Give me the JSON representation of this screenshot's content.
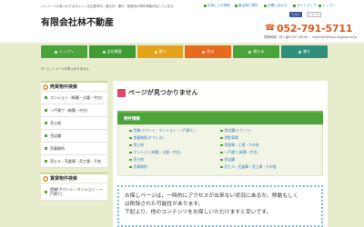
{
  "header": {
    "tagline": "ｘｘページの見つかりませんｘｘ名古屋市内・春日井・瀬戸・尾張旭の物件情報が探しています。",
    "company": "有限会社林不動産",
    "top_links": [
      {
        "label": "お気に入り物件",
        "icon": "heart-icon"
      },
      {
        "label": "最近見た物件",
        "icon": "clock-icon"
      },
      {
        "label": "お問い合わせ",
        "icon": "mail-icon"
      },
      {
        "label": "サイトマップ",
        "icon": "sitemap-icon"
      },
      {
        "label": "トップへ",
        "icon": "home-icon"
      }
    ],
    "facebook_label": "いいね！",
    "tweet_label": "ツイート",
    "tel": "052-791-5711",
    "tel_icon": "phone-icon",
    "hours": "営業時間／月～金9:30～18:00 ｜ fudo-sen@mun.bigjobe.ne.jp"
  },
  "nav": [
    {
      "label": "トップへ",
      "color": "#4aa33b"
    },
    {
      "label": "会社概要",
      "color": "#3f9b34"
    },
    {
      "label": "買う",
      "color": "#e3a31b"
    },
    {
      "label": "売る",
      "color": "#e86a1f"
    },
    {
      "label": "借りる",
      "color": "#4aa33b"
    },
    {
      "label": "貸す",
      "color": "#2e8f7a"
    }
  ],
  "breadcrumb": "ホーム ＞ ページが見つかりません",
  "sidebar": {
    "heading": "売買物件検索",
    "heading_icon": "circle-bullet-icon",
    "items": [
      {
        "label": "マンション（新築・分譲・中古）"
      },
      {
        "label": "一戸建て（新築・中古）"
      },
      {
        "label": "売土地"
      },
      {
        "label": "売店舗"
      },
      {
        "label": "売事務所"
      },
      {
        "label": "売ビル・売倉庫・売工場・そ他"
      }
    ],
    "heading2": "賃貸物件検索",
    "items2": [
      {
        "label": "賃貸(アパート・マンション・一戸建て)"
      }
    ]
  },
  "main": {
    "title": "ページが見つかりません",
    "list_heading": "物件情報",
    "property_links": [
      [
        "賃貸(アパート・マンション・一戸建て)",
        "賃店舗(テナント)"
      ],
      [
        "賃事務所(オフィス)",
        "賃駐車場"
      ],
      [
        "賃土地",
        "賃倉庫・工場・その他"
      ],
      [
        "マンション(新築・分譲・中古)",
        "一戸建て(新築・中古)"
      ],
      [
        "売土地",
        "売店舗"
      ],
      [
        "売事務所",
        "売ビル・売倉庫・売工場・その他"
      ]
    ],
    "message_lines": [
      "お探しページは、一時的にアクセスが出来ない状況にあるか、移動もしく",
      "は削除された可能性があります。",
      "下記より、他のコンテンツをお探しいただけますと幸いです。"
    ]
  }
}
